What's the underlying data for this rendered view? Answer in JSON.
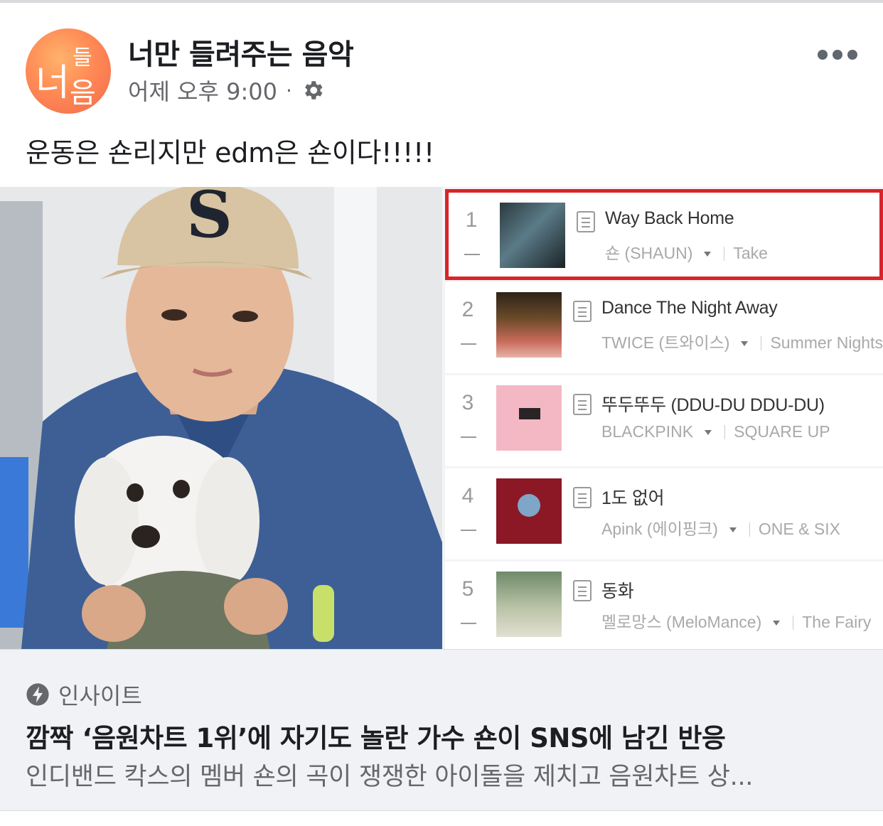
{
  "post": {
    "page_name": "너만 들려주는 음악",
    "avatar_text": [
      "너",
      "들",
      "음"
    ],
    "time": "어제 오후 9:00",
    "dot": "·",
    "audience_icon": "gear-icon",
    "more_icon": "more-options-icon",
    "text": "운동은 숀리지만 edm은 숀이다!!!!!"
  },
  "chart": {
    "rows": [
      {
        "rank": "1",
        "title": "Way Back Home",
        "artist": "숀 (SHAUN)",
        "album": "Take",
        "highlighted": true
      },
      {
        "rank": "2",
        "title": "Dance The Night Away",
        "artist": "TWICE (트와이스)",
        "album": "Summer Nights",
        "highlighted": false
      },
      {
        "rank": "3",
        "title": "뚜두뚜두 (DDU-DU DDU-DU)",
        "artist": "BLACKPINK",
        "album": "SQUARE UP",
        "highlighted": false
      },
      {
        "rank": "4",
        "title": "1도 없어",
        "artist": "Apink (에이핑크)",
        "album": "ONE & SIX",
        "highlighted": false
      },
      {
        "rank": "5",
        "title": "동화",
        "artist": "멜로망스 (MeloMance)",
        "album": "The Fairy",
        "highlighted": false
      }
    ],
    "highlight_color": "#d8242a"
  },
  "link": {
    "source": "인사이트",
    "source_icon": "bolt-icon",
    "title": "깜짝 ‘음원차트 1위’에 자기도 놀란 가수 숀이 SNS에 남긴 반응",
    "description": "인디밴드 칵스의 멤버 숀의 곡이 쟁쟁한 아이돌을 제치고 음원차트 상..."
  }
}
